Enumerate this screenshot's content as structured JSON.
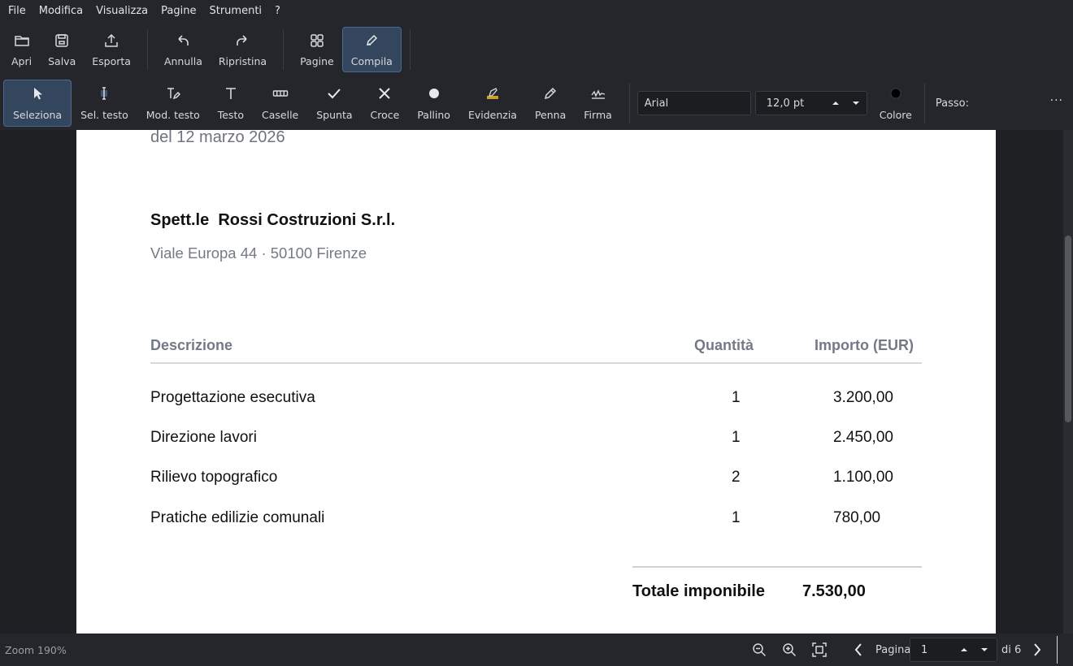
{
  "menu": [
    "File",
    "Modifica",
    "Visualizza",
    "Pagine",
    "Strumenti",
    "?"
  ],
  "toolbar": {
    "apri": "Apri",
    "salva": "Salva",
    "esporta": "Esporta",
    "annulla": "Annulla",
    "ripristina": "Ripristina",
    "pagine": "Pagine",
    "compila": "Compila"
  },
  "tools": {
    "seleziona": "Seleziona",
    "sel_testo": "Sel. testo",
    "mod_testo": "Mod. testo",
    "testo": "Testo",
    "caselle": "Caselle",
    "spunta": "Spunta",
    "croce": "Croce",
    "pallino": "Pallino",
    "evidenzia": "Evidenzia",
    "penna": "Penna",
    "firma": "Firma",
    "colore": "Colore",
    "active": "Seleziona",
    "highlight_color": "#c9a227"
  },
  "format": {
    "font": "Arial",
    "size": "12,0 pt",
    "color": "#000000",
    "passo_label": "Passo:",
    "more": "···"
  },
  "document": {
    "date_line": "del 12 marzo 2026",
    "recipient": "Spett.le  Rossi Costruzioni S.r.l.",
    "address": "Viale Europa 44 · 50100 Firenze",
    "table": {
      "headers": [
        "Descrizione",
        "Quantità",
        "Importo (EUR)"
      ],
      "rows": [
        [
          "Progettazione esecutiva",
          "1",
          "3.200,00"
        ],
        [
          "Direzione lavori",
          "1",
          "2.450,00"
        ],
        [
          "Rilievo topografico",
          "2",
          "1.100,00"
        ],
        [
          "Pratiche edilizie comunali",
          "1",
          "780,00"
        ]
      ]
    },
    "total_label": "Totale imponibile",
    "total_value": "7.530,00"
  },
  "status": {
    "zoom": "Zoom 190%",
    "pagina_label": "Pagina",
    "page_value": "1",
    "page_total": "di 6"
  },
  "colors": {
    "accent": "#34465e",
    "accent_border": "#4b6a8f",
    "background": "#1f2023",
    "toolbar": "#24262b"
  }
}
